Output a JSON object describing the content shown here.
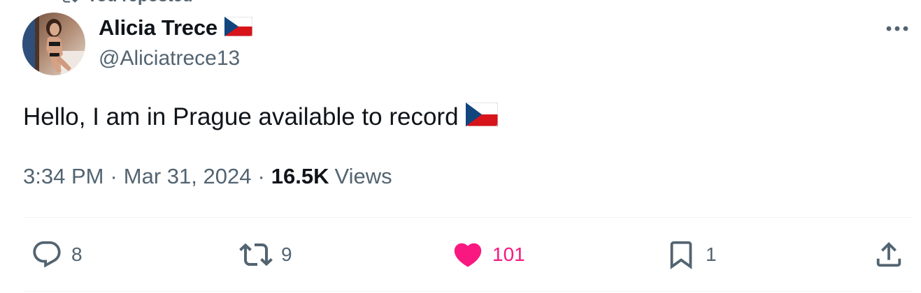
{
  "repost_header": {
    "text": "You reposted"
  },
  "author": {
    "name": "Alicia Trece",
    "handle": "@Aliciatrece13",
    "flag_icon": "czech-flag-icon"
  },
  "tweet": {
    "text": "Hello, I am in Prague available to record",
    "flag_icon": "czech-flag-icon"
  },
  "meta": {
    "time": "3:34 PM",
    "separator": "·",
    "date": "Mar 31, 2024",
    "views_count": "16.5K",
    "views_label": "Views"
  },
  "actions": {
    "reply_count": "8",
    "retweet_count": "9",
    "like_count": "101",
    "bookmark_count": "1"
  },
  "colors": {
    "text_primary": "#0f1419",
    "text_secondary": "#536471",
    "like_active": "#f91880",
    "divider": "#eff3f4"
  }
}
